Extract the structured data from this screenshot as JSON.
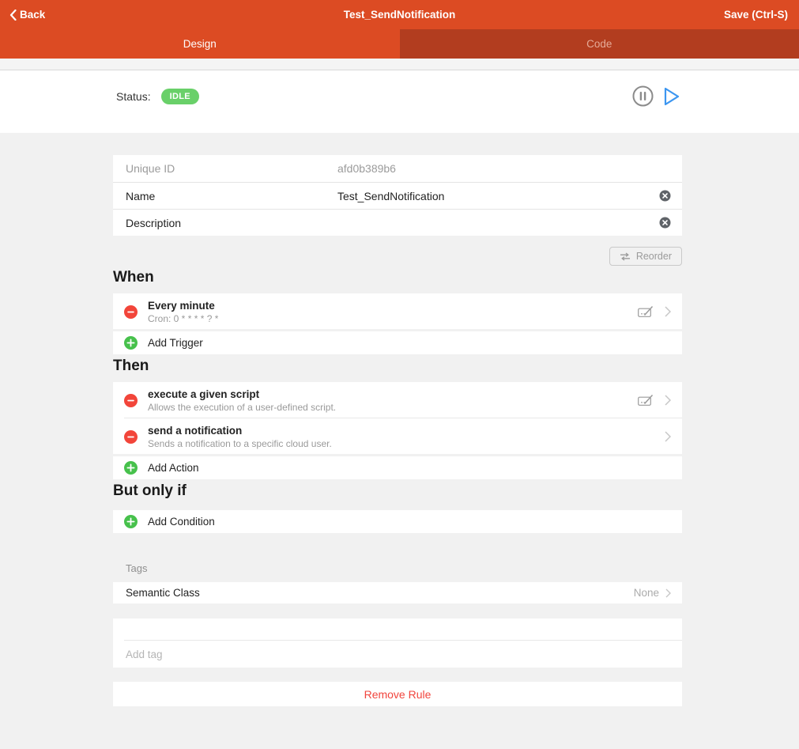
{
  "topbar": {
    "back_label": "Back",
    "title": "Test_SendNotification",
    "save_label": "Save (Ctrl-S)"
  },
  "tabs": [
    {
      "label": "Design",
      "active": true
    },
    {
      "label": "Code",
      "active": false
    }
  ],
  "status": {
    "label": "Status:",
    "badge": "IDLE"
  },
  "details": {
    "unique_id_label": "Unique ID",
    "unique_id_value": "afd0b389b6",
    "name_label": "Name",
    "name_value": "Test_SendNotification",
    "description_label": "Description",
    "description_value": ""
  },
  "toolbar": {
    "reorder_label": "Reorder"
  },
  "when": {
    "heading": "When",
    "triggers": [
      {
        "title": "Every minute",
        "subtitle": "Cron: 0 * * * * ? *"
      }
    ],
    "add_label": "Add Trigger"
  },
  "then": {
    "heading": "Then",
    "actions": [
      {
        "title": "execute a given script",
        "subtitle": "Allows the execution of a user-defined script."
      },
      {
        "title": "send a notification",
        "subtitle": "Sends a notification to a specific cloud user."
      }
    ],
    "add_label": "Add Action"
  },
  "but_only_if": {
    "heading": "But only if",
    "add_label": "Add Condition"
  },
  "tags": {
    "section_label": "Tags",
    "semantic_class_label": "Semantic Class",
    "semantic_class_value": "None",
    "add_tag_placeholder": "Add tag"
  },
  "remove": {
    "label": "Remove Rule"
  },
  "icons": {
    "back": "chevron-left-icon",
    "pause": "pause-circle-icon",
    "play": "play-icon",
    "clear": "clear-circle-icon",
    "remove_item": "minus-circle-icon",
    "add_item": "plus-circle-icon",
    "edit": "edit-icon",
    "chevron": "chevron-right-icon",
    "reorder": "reorder-arrows-icon"
  },
  "colors": {
    "accent_orange": "#dc4b23",
    "tab_inactive_dark": "#b23d1f",
    "badge_green": "#69d069",
    "add_green": "#47c14c",
    "remove_red": "#f2453a",
    "play_blue": "#3c96f0",
    "page_background": "#f1f1f1"
  }
}
